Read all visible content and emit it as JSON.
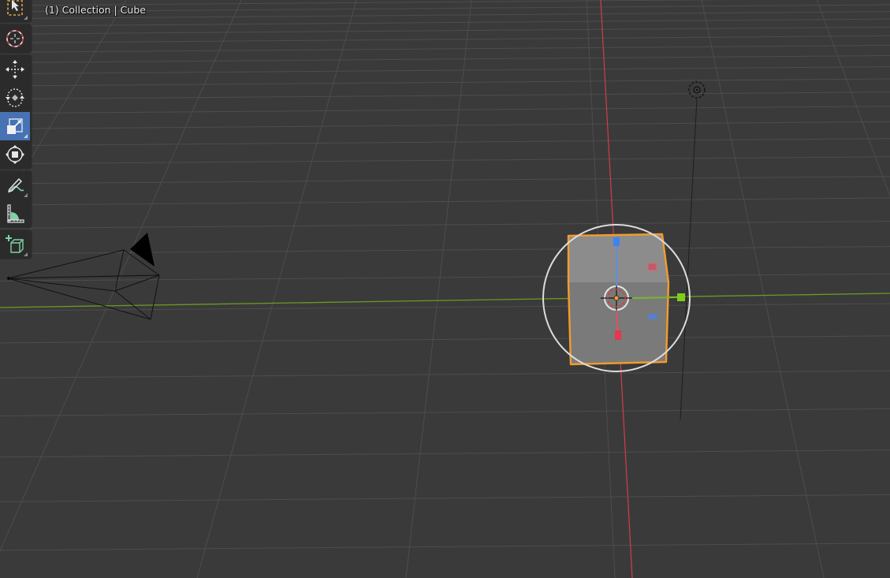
{
  "viewport": {
    "overlay_text": "(1) Collection | Cube",
    "background_color": "#3a3a3a",
    "grid_color": "#4d4d4d",
    "x_axis_color": "#d33d48",
    "y_axis_color": "#6a9a22",
    "selection_color": "#f39c2b"
  },
  "toolbar": {
    "active_tool": "scale",
    "active_color": "#4772b3",
    "tools": [
      {
        "id": "select-box",
        "label": "Select Box"
      },
      {
        "id": "cursor",
        "label": "Cursor"
      },
      {
        "id": "move",
        "label": "Move"
      },
      {
        "id": "rotate",
        "label": "Rotate"
      },
      {
        "id": "scale",
        "label": "Scale"
      },
      {
        "id": "transform",
        "label": "Transform"
      },
      {
        "id": "annotate",
        "label": "Annotate"
      },
      {
        "id": "measure",
        "label": "Measure"
      },
      {
        "id": "add-cube",
        "label": "Add Cube"
      }
    ]
  },
  "scene": {
    "objects": [
      {
        "name": "Cube",
        "type": "mesh",
        "selected": true
      },
      {
        "name": "Camera",
        "type": "camera",
        "selected": false
      },
      {
        "name": "Light",
        "type": "light",
        "selected": false
      }
    ]
  }
}
